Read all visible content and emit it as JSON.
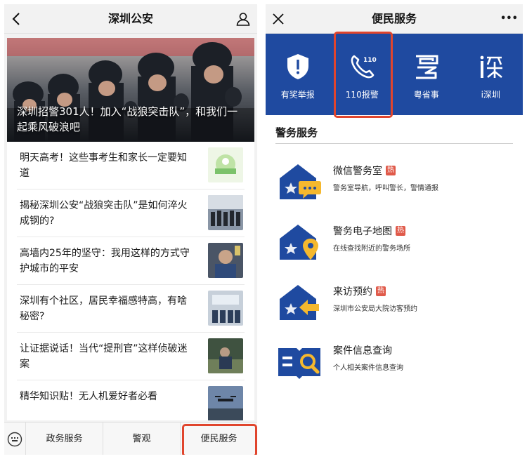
{
  "left": {
    "navbar": {
      "title": "深圳公安"
    },
    "hero": {
      "title": "深圳招警301人！加入“战狼突击队”，和我们一起乘风破浪吧"
    },
    "articles": [
      {
        "title": "明天高考！这些事考生和家长一定要知道"
      },
      {
        "title": "揭秘深圳公安“战狼突击队”是如何淬火成钢的?"
      },
      {
        "title": "高墙内25年的坚守：我用这样的方式守护城市的平安"
      },
      {
        "title": "深圳有个社区，居民幸福感特高，有啥秘密?"
      },
      {
        "title": "让证据说话！当代“提刑官”这样侦破迷案"
      },
      {
        "title": "精华知识贴！无人机爱好者必看"
      }
    ],
    "tabbar": {
      "tabs": [
        {
          "label": "政务服务"
        },
        {
          "label": "警观"
        },
        {
          "label": "便民服务"
        }
      ]
    }
  },
  "right": {
    "navbar": {
      "title": "便民服务",
      "more": "•••"
    },
    "services": [
      {
        "label": "有奖举报",
        "icon": "shield-alert-icon"
      },
      {
        "label": "110报警",
        "icon": "phone-110-icon"
      },
      {
        "label": "粤省事",
        "icon": "yue-logo-icon"
      },
      {
        "label": "i深圳",
        "icon": "i-shenzhen-logo-icon"
      }
    ],
    "section": {
      "title": "警务服务"
    },
    "items": [
      {
        "title": "微信警务室",
        "hot": "热",
        "desc": "警务室导航，呼叫警长，警情通报",
        "icon": "police-chat-icon"
      },
      {
        "title": "警务电子地图",
        "hot": "热",
        "desc": "在线查找附近的警务场所",
        "icon": "police-map-icon"
      },
      {
        "title": "来访预约",
        "hot": "热",
        "desc": "深圳市公安局大院访客预约",
        "icon": "police-visit-icon"
      },
      {
        "title": "案件信息查询",
        "hot": "",
        "desc": "个人相关案件信息查询",
        "icon": "case-search-icon"
      }
    ]
  },
  "colors": {
    "brand_blue": "#1f4aa0",
    "highlight_red": "#e0452d",
    "accent_yellow": "#f5b82e",
    "hot_red": "#e05a4a"
  }
}
